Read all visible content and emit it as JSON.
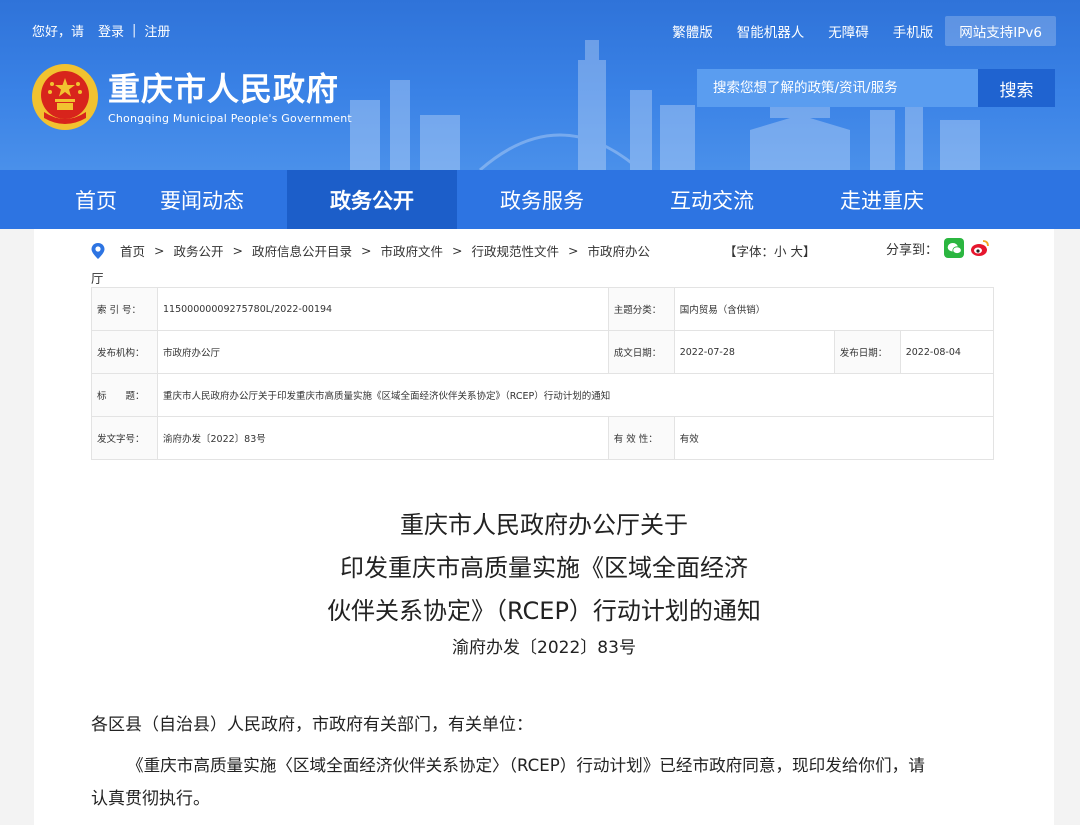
{
  "topbar": {
    "greeting": "您好，请",
    "login": "登录",
    "register": "注册",
    "links": [
      "繁體版",
      "智能机器人",
      "无障碍",
      "手机版"
    ],
    "ipv6": "网站支持IPv6"
  },
  "logo": {
    "cn": "重庆市人民政府",
    "en": "Chongqing Municipal People's Government"
  },
  "search": {
    "placeholder": "搜索您想了解的政策/资讯/服务",
    "button": "搜索"
  },
  "nav": [
    "首页",
    "要闻动态",
    "政务公开",
    "政务服务",
    "互动交流",
    "走进重庆"
  ],
  "breadcrumb": [
    "首页",
    "政务公开",
    "政府信息公开目录",
    "市政府文件",
    "行政规范性文件",
    "市政府办公"
  ],
  "breadcrumb_wrap": "厅",
  "fontsize": "【字体：小 大】",
  "share_label": "分享到：",
  "meta": {
    "index_label": "索 引 号：",
    "index_value": "11500000009275780L/2022-00194",
    "topic_label": "主题分类：",
    "topic_value": "国内贸易（含供销）",
    "issuer_label": "发布机构：",
    "issuer_value": "市政府办公厅",
    "created_label": "成文日期：",
    "created_value": "2022-07-28",
    "published_label": "发布日期：",
    "published_value": "2022-08-04",
    "title_label": "标　　题：",
    "title_value": "重庆市人民政府办公厅关于印发重庆市高质量实施《区域全面经济伙伴关系协定》（RCEP）行动计划的通知",
    "docno_label": "发文字号：",
    "docno_value": "渝府办发〔2022〕83号",
    "valid_label": "有 效 性：",
    "valid_value": "有效"
  },
  "document": {
    "title_lines": [
      "重庆市人民政府办公厅关于",
      "印发重庆市高质量实施《区域全面经济",
      "伙伴关系协定》（RCEP）行动计划的通知"
    ],
    "doc_number": "渝府办发〔2022〕83号",
    "salutation": "各区县（自治县）人民政府，市政府有关部门，有关单位：",
    "body_line1": "《重庆市高质量实施〈区域全面经济伙伴关系协定〉（RCEP）行动计划》已经市政府同意，现印发给你们，请",
    "body_line2": "认真贯彻执行。"
  }
}
